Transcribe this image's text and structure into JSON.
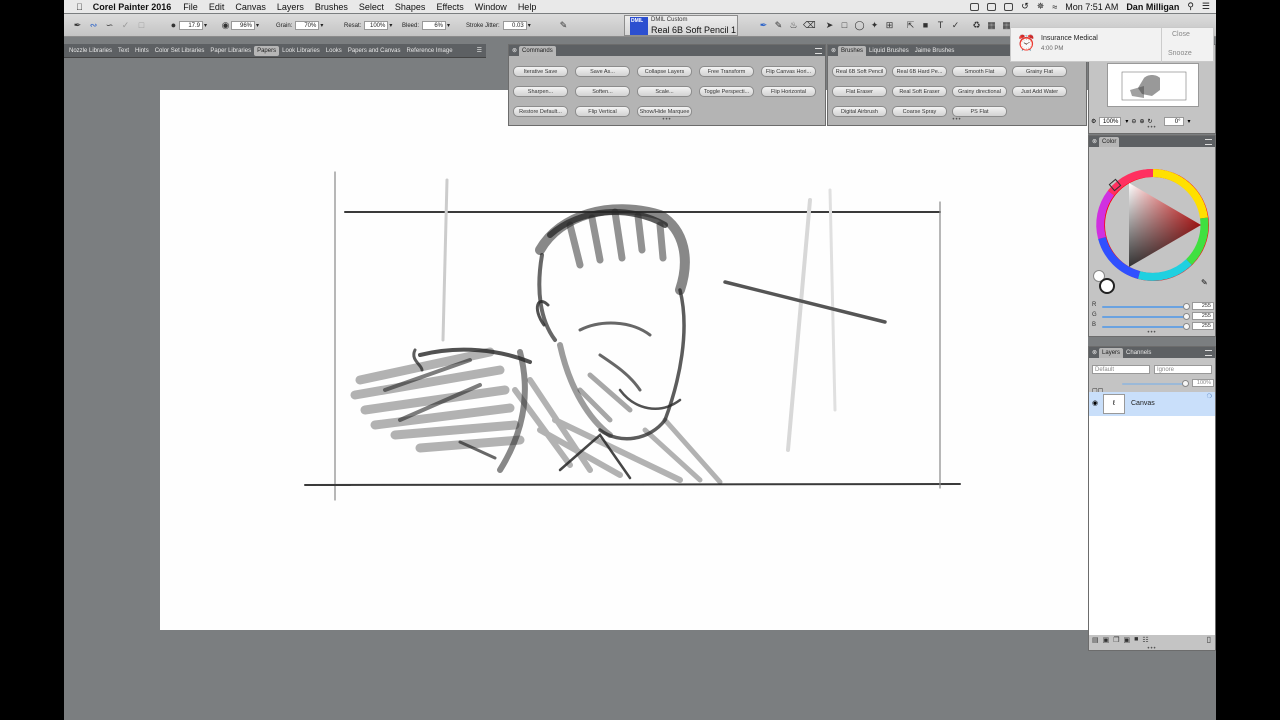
{
  "menubar": {
    "apple": "",
    "app_name": "Corel Painter 2016",
    "items": [
      "File",
      "Edit",
      "Canvas",
      "Layers",
      "Brushes",
      "Select",
      "Shapes",
      "Effects",
      "Window",
      "Help"
    ],
    "clock": "Mon 7:51 AM",
    "user": "Dan Milligan"
  },
  "property_bar": {
    "size": "17.9",
    "opacity": "96%",
    "grain_label": "Grain:",
    "grain": "70%",
    "resat_label": "Resat:",
    "resat": "100%",
    "bleed_label": "Bleed:",
    "bleed": "6%",
    "stroke_jitter_label": "Stroke Jitter:",
    "stroke_jitter": "0.03"
  },
  "brush_selector": {
    "swatch_label": "DMIL",
    "category": "DMIL Custom",
    "variant": "Real 6B Soft Pencil 1"
  },
  "library_tabs": {
    "tabs": [
      "Nozzle Libraries",
      "Text",
      "Hints",
      "Color Set Libraries",
      "Paper Libraries",
      "Papers",
      "Look Libraries",
      "Looks",
      "Papers and Canvas",
      "Reference Image"
    ],
    "active": "Papers"
  },
  "commands_panel": {
    "title": "Commands",
    "buttons": [
      "Iterative Save",
      "Save As...",
      "Collapse Layers",
      "Free Transform",
      "Flip Canvas Hori...",
      "Sharpen...",
      "Soften...",
      "Scale...",
      "Toggle Perspecti...",
      "Flip Horizontal",
      "Restore Default...",
      "Flip Vertical",
      "Show/Hide Marquee"
    ]
  },
  "brushes_panel": {
    "tabs": [
      "Brushes",
      "Liquid Brushes",
      "Jaime Brushes"
    ],
    "buttons": [
      "Real 6B Soft Pencil",
      "Real 6B Hard Pe...",
      "Smooth Flat",
      "Grainy Flat",
      "Flat Eraser",
      "Real Soft Eraser",
      "Grainy directional",
      "Just Add Water",
      "Digital Airbrush",
      "Coarse Spray",
      "PS Flat"
    ]
  },
  "notification": {
    "title": "Insurance Medical",
    "time": "4:00 PM",
    "close": "Close",
    "snooze": "Snooze"
  },
  "navigator_panel": {
    "zoom": "100%",
    "rotation": "0°"
  },
  "color_panel": {
    "title": "Color",
    "r_label": "R",
    "g_label": "G",
    "b_label": "B",
    "r": "255",
    "g": "255",
    "b": "255"
  },
  "layers_panel": {
    "tabs": [
      "Layers",
      "Channels"
    ],
    "composite_method": "Default",
    "preserve": "Ignore",
    "opacity": "100%",
    "layer_name": "Canvas"
  }
}
